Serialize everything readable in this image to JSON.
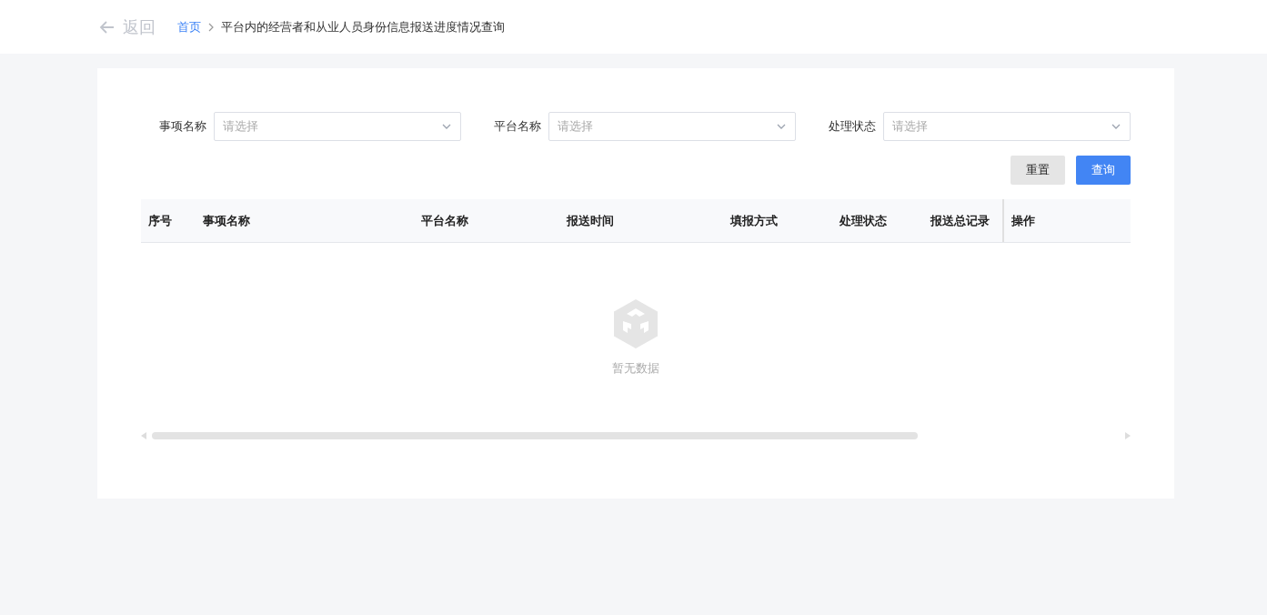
{
  "header": {
    "back": "返回",
    "breadcrumb": [
      {
        "label": "首页",
        "link": true
      },
      {
        "label": "平台内的经营者和从业人员身份信息报送进度情况查询",
        "link": false
      }
    ]
  },
  "filters": [
    {
      "label": "事项名称",
      "placeholder": "请选择"
    },
    {
      "label": "平台名称",
      "placeholder": "请选择"
    },
    {
      "label": "处理状态",
      "placeholder": "请选择"
    }
  ],
  "buttons": [
    {
      "label": "重置",
      "kind": "default"
    },
    {
      "label": "查询",
      "kind": "primary"
    }
  ],
  "table": {
    "columns": [
      "序号",
      "事项名称",
      "平台名称",
      "报送时间",
      "填报方式",
      "处理状态",
      "报送总记录",
      "操作"
    ],
    "empty_text": "暂无数据"
  }
}
